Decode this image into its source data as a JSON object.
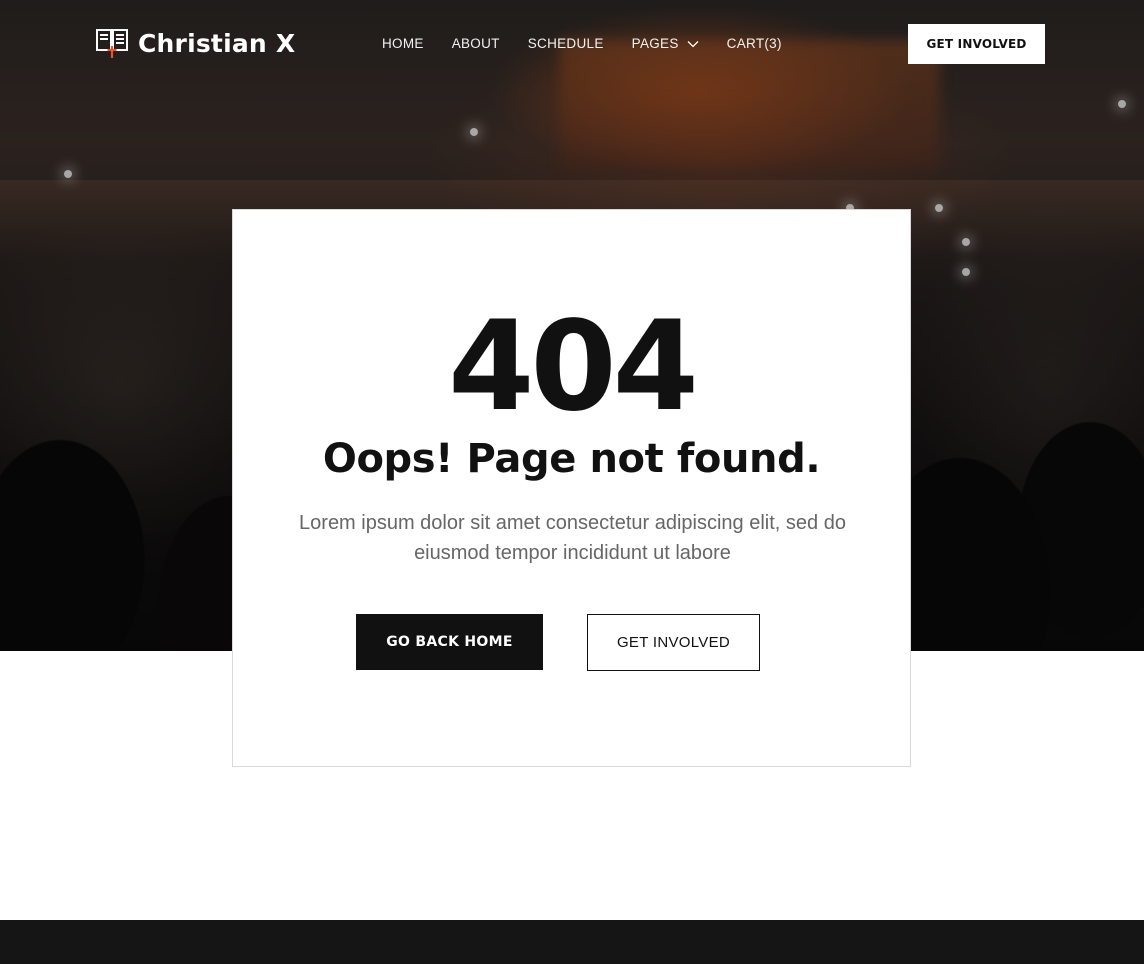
{
  "brand": {
    "name": "Christian X",
    "logo_icon": "bible-cross-icon",
    "accent_color": "#e8542b"
  },
  "nav": {
    "items": [
      {
        "label": "HOME"
      },
      {
        "label": "ABOUT"
      },
      {
        "label": "SCHEDULE"
      },
      {
        "label": "PAGES",
        "icon": "chevron-down-icon"
      },
      {
        "label": "CART(3)"
      }
    ],
    "cta_label": "GET INVOLVED"
  },
  "hero": {
    "background": "concert-crowd-photo"
  },
  "error": {
    "code": "404",
    "headline": "Oops! Page not found.",
    "description": "Lorem ipsum dolor sit amet consectetur adipiscing elit, sed do eiusmod tempor incididunt ut labore",
    "primary_button": "GO BACK HOME",
    "secondary_button": "GET INVOLVED"
  },
  "colors": {
    "dark": "#111111",
    "text_muted": "#666666",
    "footer": "#151515"
  }
}
